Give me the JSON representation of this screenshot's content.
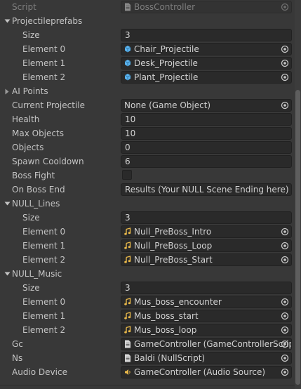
{
  "inspector": {
    "script": {
      "label": "Script",
      "value": "BossController",
      "icon": "script-file-icon"
    },
    "projectile_prefabs": {
      "label": "Projectileprefabs",
      "expanded": true,
      "size_label": "Size",
      "size": "3",
      "elements": [
        {
          "label": "Element 0",
          "value": "Chair_Projectile",
          "icon": "prefab-cube-icon"
        },
        {
          "label": "Element 1",
          "value": "Desk_Projectile",
          "icon": "prefab-cube-icon"
        },
        {
          "label": "Element 2",
          "value": "Plant_Projectile",
          "icon": "prefab-cube-icon"
        }
      ]
    },
    "ai_points": {
      "label": "AI Points",
      "expanded": false
    },
    "current_projectile": {
      "label": "Current Projectile",
      "value": "None (Game Object)"
    },
    "health": {
      "label": "Health",
      "value": "10"
    },
    "max_objects": {
      "label": "Max Objects",
      "value": "10"
    },
    "objects": {
      "label": "Objects",
      "value": "0"
    },
    "spawn_cooldown": {
      "label": "Spawn Cooldown",
      "value": "6"
    },
    "boss_fight": {
      "label": "Boss Fight",
      "checked": false
    },
    "on_boss_end": {
      "label": "On Boss End",
      "value": "Results (Your NULL Scene Ending here)"
    },
    "null_lines": {
      "label": "NULL_Lines",
      "expanded": true,
      "size_label": "Size",
      "size": "3",
      "elements": [
        {
          "label": "Element 0",
          "value": "Null_PreBoss_Intro",
          "icon": "audio-clip-icon"
        },
        {
          "label": "Element 1",
          "value": "Null_PreBoss_Loop",
          "icon": "audio-clip-icon"
        },
        {
          "label": "Element 2",
          "value": "Null_PreBoss_Start",
          "icon": "audio-clip-icon"
        }
      ]
    },
    "null_music": {
      "label": "NULL_Music",
      "expanded": true,
      "size_label": "Size",
      "size": "3",
      "elements": [
        {
          "label": "Element 0",
          "value": "Mus_boss_encounter",
          "icon": "audio-clip-icon"
        },
        {
          "label": "Element 1",
          "value": "Mus_boss_start",
          "icon": "audio-clip-icon"
        },
        {
          "label": "Element 2",
          "value": "Mus_boss_loop",
          "icon": "audio-clip-icon"
        }
      ]
    },
    "gc": {
      "label": "Gc",
      "value": "GameController (GameControllerScript)",
      "icon": "script-file-icon"
    },
    "ns": {
      "label": "Ns",
      "value": "Baldi (NullScript)",
      "icon": "script-file-icon"
    },
    "audio_device": {
      "label": "Audio Device",
      "value": "GameController (Audio Source)",
      "icon": "speaker-icon"
    }
  },
  "colors": {
    "background": "#383838",
    "field_background": "#2a2a2a",
    "label_text": "#c4c4c4",
    "dim_text": "#7e7e7e",
    "prefab_icon": "#5ab4f0",
    "audio_icon": "#e8b84a"
  }
}
